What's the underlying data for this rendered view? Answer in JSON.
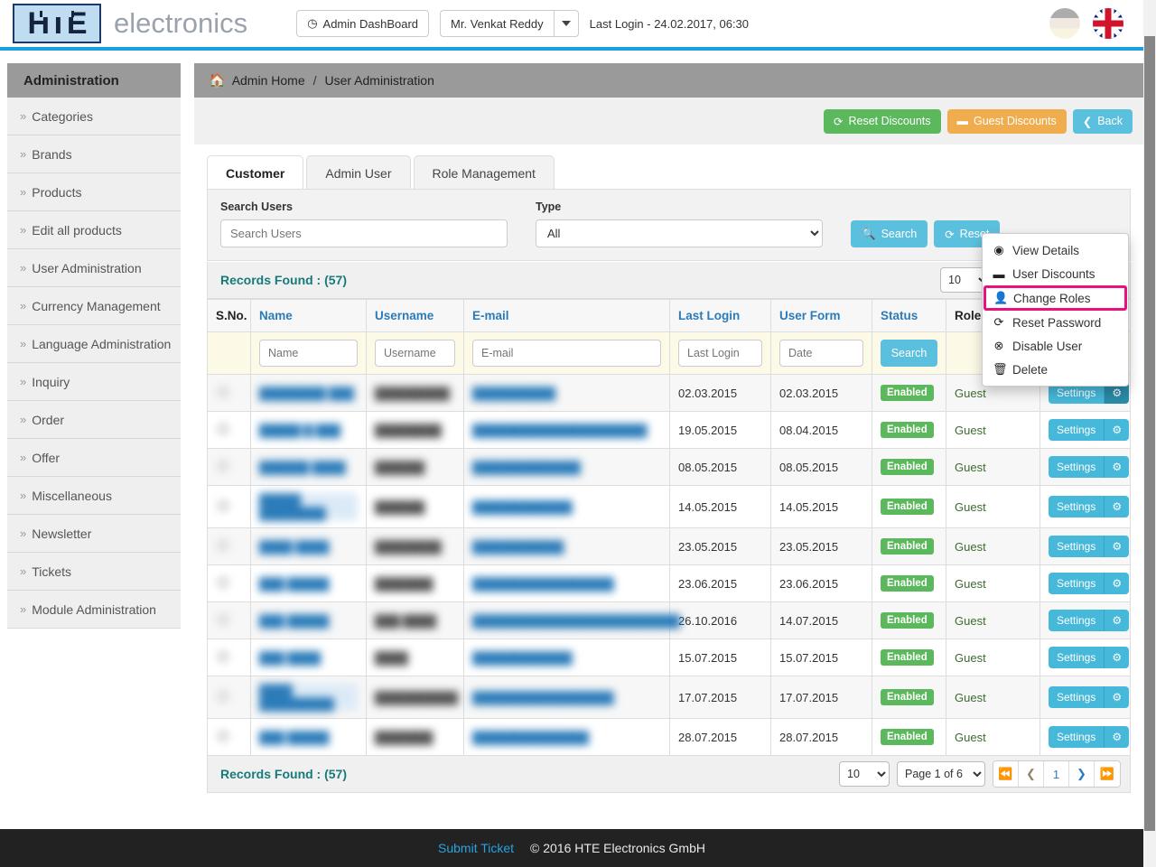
{
  "header": {
    "logo_text": "HTE",
    "brand_word": "electronics",
    "admin_dashboard_label": "Admin DashBoard",
    "user_name": "Mr. Venkat Reddy",
    "last_login": "Last Login - 24.02.2017, 06:30",
    "flag_de": "german-flag-icon",
    "flag_uk": "uk-flag-icon"
  },
  "sidebar": {
    "title": "Administration",
    "items": [
      {
        "label": "Categories"
      },
      {
        "label": "Brands"
      },
      {
        "label": "Products"
      },
      {
        "label": "Edit all products"
      },
      {
        "label": "User Administration"
      },
      {
        "label": "Currency Management"
      },
      {
        "label": "Language Administration"
      },
      {
        "label": "Inquiry"
      },
      {
        "label": "Order"
      },
      {
        "label": "Offer"
      },
      {
        "label": "Miscellaneous"
      },
      {
        "label": "Newsletter"
      },
      {
        "label": "Tickets"
      },
      {
        "label": "Module Administration"
      }
    ]
  },
  "breadcrumb": {
    "home": "Admin Home",
    "separator": "/",
    "current": "User Administration"
  },
  "toolbar": {
    "reset_discounts": "Reset Discounts",
    "guest_discounts": "Guest Discounts",
    "back": "Back"
  },
  "tabs": [
    {
      "label": "Customer",
      "active": true
    },
    {
      "label": "Admin User",
      "active": false
    },
    {
      "label": "Role Management",
      "active": false
    }
  ],
  "search": {
    "users_label": "Search Users",
    "users_placeholder": "Search Users",
    "users_value": "",
    "type_label": "Type",
    "type_value": "All",
    "search_button": "Search",
    "reset_button": "Reset"
  },
  "records": {
    "found_label": "Records Found : (57)",
    "rows_per_page": "10",
    "page_indicator": "Page 1 of 6",
    "current_page": "1"
  },
  "table": {
    "columns": [
      "S.No.",
      "Name",
      "Username",
      "E-mail",
      "Last Login",
      "User Form",
      "Status",
      "Role",
      ""
    ],
    "filters": {
      "name_placeholder": "Name",
      "username_placeholder": "Username",
      "email_placeholder": "E-mail",
      "lastlogin_placeholder": "Last Login",
      "userform_placeholder": "Date",
      "search_button": "Search"
    },
    "rows": [
      {
        "sno": "",
        "name": "████████ ███",
        "username": "█████████",
        "email": "██████████",
        "last_login": "02.03.2015",
        "user_form": "02.03.2015",
        "status": "Enabled",
        "role": "Guest",
        "settings": "Settings",
        "menu_open": true
      },
      {
        "sno": "",
        "name": "█████ █ ███",
        "username": "████████",
        "email": "█████████████████████",
        "last_login": "19.05.2015",
        "user_form": "08.04.2015",
        "status": "Enabled",
        "role": "Guest",
        "settings": "Settings",
        "menu_open": false
      },
      {
        "sno": "",
        "name": "██████ ████",
        "username": "██████",
        "email": "█████████████",
        "last_login": "08.05.2015",
        "user_form": "08.05.2015",
        "status": "Enabled",
        "role": "Guest",
        "settings": "Settings",
        "menu_open": false
      },
      {
        "sno": "",
        "name": "█████ ████████",
        "username": "██████",
        "email": "████████████",
        "last_login": "14.05.2015",
        "user_form": "14.05.2015",
        "status": "Enabled",
        "role": "Guest",
        "settings": "Settings",
        "menu_open": false
      },
      {
        "sno": "",
        "name": "████ ████",
        "username": "████████",
        "email": "███████████",
        "last_login": "23.05.2015",
        "user_form": "23.05.2015",
        "status": "Enabled",
        "role": "Guest",
        "settings": "Settings",
        "menu_open": false
      },
      {
        "sno": "",
        "name": "███ █████",
        "username": "███████",
        "email": "█████████████████",
        "last_login": "23.06.2015",
        "user_form": "23.06.2015",
        "status": "Enabled",
        "role": "Guest",
        "settings": "Settings",
        "menu_open": false
      },
      {
        "sno": "",
        "name": "███ █████",
        "username": "███ ████",
        "email": "█████████████████████████",
        "last_login": "26.10.2016",
        "user_form": "14.07.2015",
        "status": "Enabled",
        "role": "Guest",
        "settings": "Settings",
        "menu_open": false
      },
      {
        "sno": "",
        "name": "███ ████",
        "username": "████",
        "email": "████████████",
        "last_login": "15.07.2015",
        "user_form": "15.07.2015",
        "status": "Enabled",
        "role": "Guest",
        "settings": "Settings",
        "menu_open": false
      },
      {
        "sno": "",
        "name": "████ █████████",
        "username": "██████████",
        "email": "█████████████████",
        "last_login": "17.07.2015",
        "user_form": "17.07.2015",
        "status": "Enabled",
        "role": "Guest",
        "settings": "Settings",
        "menu_open": false
      },
      {
        "sno": "",
        "name": "███ █████",
        "username": "███████",
        "email": "██████████████",
        "last_login": "28.07.2015",
        "user_form": "28.07.2015",
        "status": "Enabled",
        "role": "Guest",
        "settings": "Settings",
        "menu_open": false
      }
    ]
  },
  "context_menu": {
    "items": [
      {
        "label": "View Details",
        "icon": "eye-icon",
        "glyph": "◉",
        "highlighted": false
      },
      {
        "label": "User Discounts",
        "icon": "minus-icon",
        "glyph": "➖",
        "highlighted": false
      },
      {
        "label": "Change Roles",
        "icon": "user-icon",
        "glyph": "♟",
        "highlighted": true
      },
      {
        "label": "Reset Password",
        "icon": "refresh-icon",
        "glyph": "⟳",
        "highlighted": false
      },
      {
        "label": "Disable User",
        "icon": "ban-icon",
        "glyph": "⊗",
        "highlighted": false
      },
      {
        "label": "Delete",
        "icon": "trash-icon",
        "glyph": "Ὕ1",
        "highlighted": false
      }
    ],
    "highlight_color": "#e8117f"
  },
  "footer": {
    "submit_ticket": "Submit Ticket",
    "copyright": "© 2016 HTE Electronics GmbH"
  },
  "colors": {
    "accent_blue": "#1a9fe0",
    "green": "#5cb85c",
    "orange": "#f0ad4e",
    "teal": "#177a7a",
    "link_blue": "#2b7bb9"
  }
}
